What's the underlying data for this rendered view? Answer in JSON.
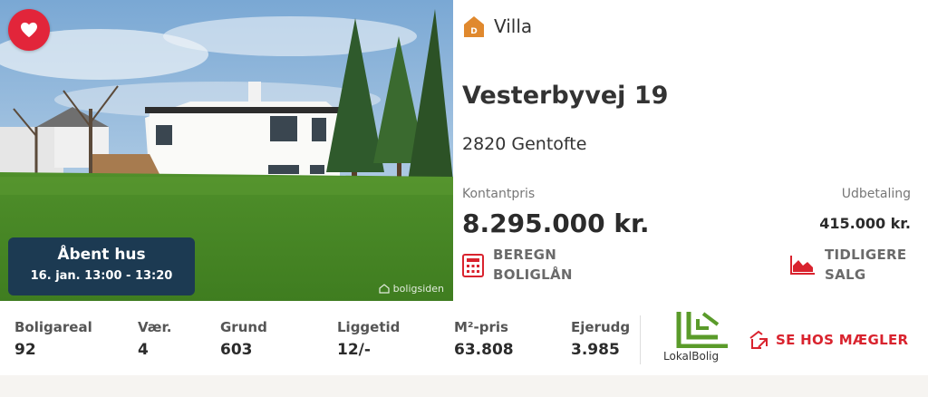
{
  "listing": {
    "open_house": {
      "title": "Åbent hus",
      "time": "16. jan. 13:00 - 13:20"
    },
    "watermark": "boligsiden",
    "energy_label": "D",
    "property_type": "Villa",
    "address": "Vesterbyvej 19",
    "city": "2820 Gentofte",
    "cash_price_label": "Kontantpris",
    "cash_price": "8.295.000 kr.",
    "down_payment_label": "Udbetaling",
    "down_payment": "415.000 kr.",
    "loan_button": {
      "line1": "BEREGN",
      "line2": "BOLIGLÅN"
    },
    "history_button": {
      "line1": "TIDLIGERE",
      "line2": "SALG"
    }
  },
  "stats": [
    {
      "label": "Boligareal",
      "value": "92"
    },
    {
      "label": "Vær.",
      "value": "4"
    },
    {
      "label": "Grund",
      "value": "603"
    },
    {
      "label": "Liggetid",
      "value": "12/-"
    },
    {
      "label": "M²-pris",
      "value": "63.808"
    },
    {
      "label": "Ejerudg",
      "value": "3.985"
    }
  ],
  "broker": {
    "logo_text": "LokalBolig",
    "cta": "SE HOS MÆGLER"
  },
  "colors": {
    "accent_red": "#d9232e",
    "heart_bg": "#e2253a",
    "badge_navy": "#1c3a52",
    "energy_orange": "#e0892e",
    "logo_green": "#5a9b2a"
  },
  "icons": {
    "favorite": "heart-icon",
    "energy": "house-badge-icon",
    "loan": "calculator-icon",
    "history": "area-chart-icon",
    "broker": "external-link-icon"
  }
}
